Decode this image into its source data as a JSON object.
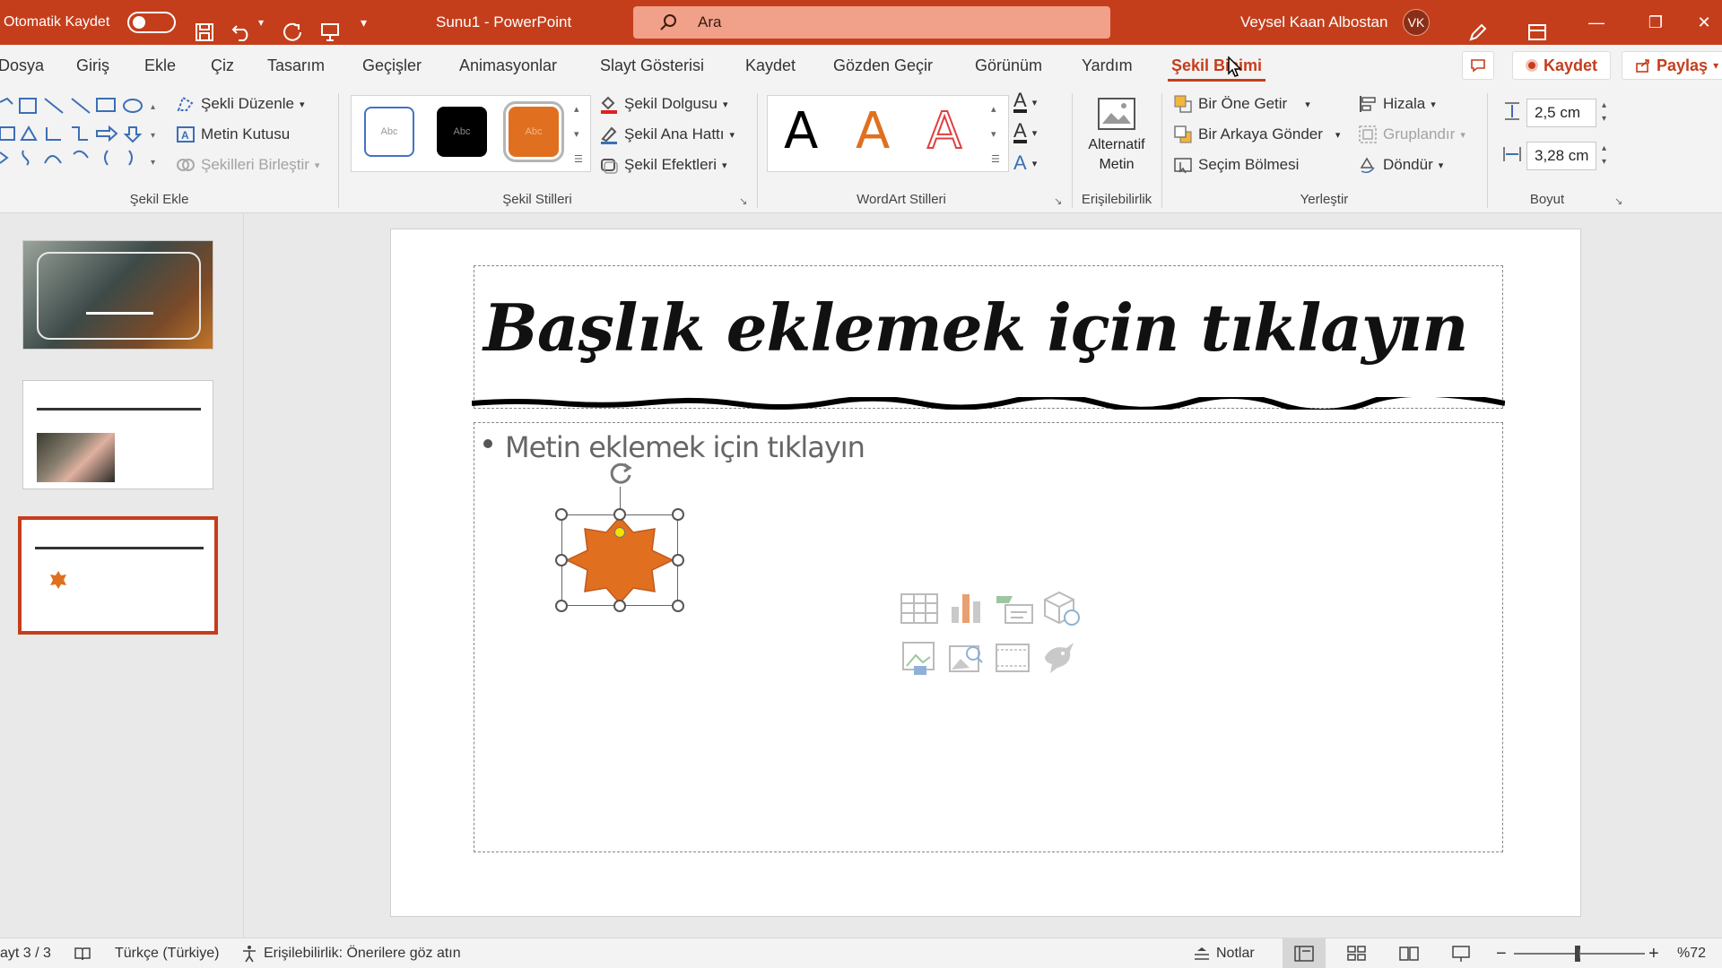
{
  "titlebar": {
    "autosave_label": "Otomatik Kaydet",
    "doc_title": "Sunu1  -  PowerPoint",
    "search_placeholder": "Ara",
    "user_name": "Veysel Kaan Albostan",
    "user_initials": "VK"
  },
  "tabs": [
    "Dosya",
    "Giriş",
    "Ekle",
    "Çiz",
    "Tasarım",
    "Geçişler",
    "Animasyonlar",
    "Slayt Gösterisi",
    "Kaydet",
    "Gözden Geçir",
    "Görünüm",
    "Yardım",
    "Şekil Biçimi"
  ],
  "actions": {
    "save": "Kaydet",
    "share": "Paylaş"
  },
  "ribbon": {
    "sekil_ekle": {
      "label": "Şekil Ekle",
      "edit_shape": "Şekli Düzenle",
      "text_box": "Metin Kutusu",
      "merge_shapes": "Şekilleri Birleştir"
    },
    "sekil_stilleri": {
      "label": "Şekil Stilleri",
      "style_sample": "Abc",
      "fill": "Şekil Dolgusu",
      "outline": "Şekil Ana Hattı",
      "effects": "Şekil Efektleri"
    },
    "wordart": {
      "label": "WordArt Stilleri",
      "letter": "A"
    },
    "erisilebilirlik": {
      "label": "Erişilebilirlik",
      "alt_text_1": "Alternatif",
      "alt_text_2": "Metin"
    },
    "yerlestir": {
      "label": "Yerleştir",
      "bring_forward": "Bir Öne Getir",
      "send_backward": "Bir Arkaya Gönder",
      "selection_pane": "Seçim Bölmesi",
      "align": "Hizala",
      "group": "Gruplandır",
      "rotate": "Döndür"
    },
    "boyut": {
      "label": "Boyut",
      "height": "2,5 cm",
      "width": "3,28 cm"
    }
  },
  "slide": {
    "title_placeholder": "Başlık eklemek için tıklayın",
    "body_placeholder": "Metin eklemek için tıklayın"
  },
  "status": {
    "slide_counter": "ayt 3 / 3",
    "language": "Türkçe (Türkiye)",
    "accessibility": "Erişilebilirlik: Önerilere göz atın",
    "notes": "Notlar",
    "zoom": "%72"
  },
  "colors": {
    "accent": "#c43e1c",
    "shape_fill": "#e07020"
  }
}
